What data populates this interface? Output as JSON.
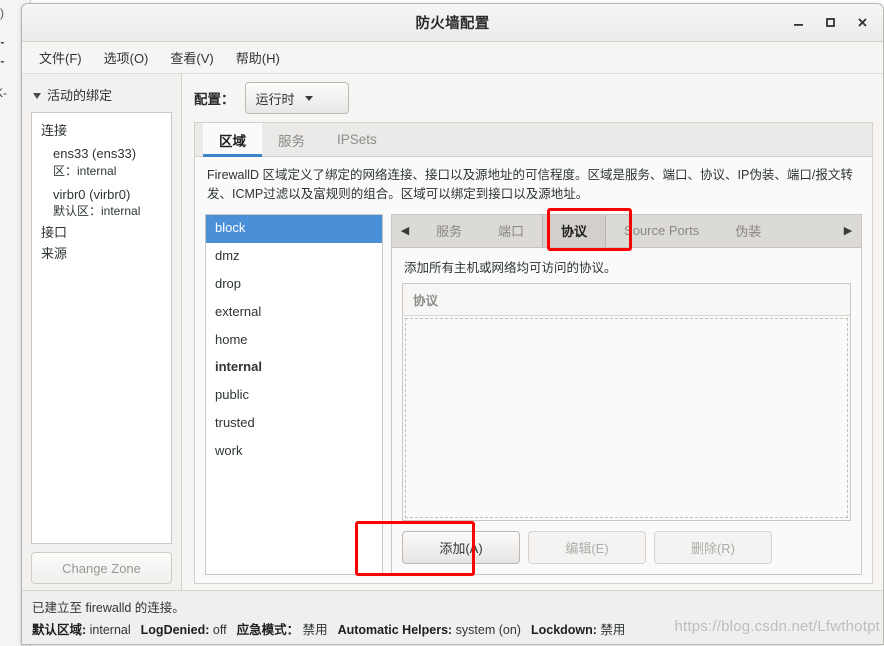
{
  "window": {
    "title": "防火墙配置",
    "controls": {
      "minimize": "minimize-icon",
      "maximize": "maximize-icon",
      "close": "close-icon"
    }
  },
  "menubar": {
    "items": [
      {
        "label": "文件(F)"
      },
      {
        "label": "选项(O)"
      },
      {
        "label": "查看(V)"
      },
      {
        "label": "帮助(H)"
      }
    ]
  },
  "sidebar": {
    "expander_label": "活动的绑定",
    "groups": [
      {
        "label": "连接"
      },
      {
        "label": "接口"
      },
      {
        "label": "来源"
      }
    ],
    "connections": [
      {
        "name": "ens33 (ens33)",
        "zone": "区：internal"
      },
      {
        "name": "virbr0 (virbr0)",
        "zone": "默认区：internal"
      }
    ],
    "change_zone_label": "Change Zone"
  },
  "config": {
    "label": "配置：",
    "selected": "运行时"
  },
  "tabs": [
    {
      "label": "区域",
      "active": true
    },
    {
      "label": "服务",
      "active": false
    },
    {
      "label": "IPSets",
      "active": false
    }
  ],
  "zone_description": "FirewallD 区域定义了绑定的网络连接、接口以及源地址的可信程度。区域是服务、端口、协议、IP伪装、端口/报文转发、ICMP过滤以及富规则的组合。区域可以绑定到接口以及源地址。",
  "zones": [
    {
      "name": "block",
      "selected": true,
      "is_default": false
    },
    {
      "name": "dmz",
      "selected": false,
      "is_default": false
    },
    {
      "name": "drop",
      "selected": false,
      "is_default": false
    },
    {
      "name": "external",
      "selected": false,
      "is_default": false
    },
    {
      "name": "home",
      "selected": false,
      "is_default": false
    },
    {
      "name": "internal",
      "selected": false,
      "is_default": true
    },
    {
      "name": "public",
      "selected": false,
      "is_default": false
    },
    {
      "name": "trusted",
      "selected": false,
      "is_default": false
    },
    {
      "name": "work",
      "selected": false,
      "is_default": false
    }
  ],
  "subtabs": {
    "prev_arrow": "◀",
    "next_arrow": "▶",
    "items": [
      {
        "label": "服务",
        "active": false
      },
      {
        "label": "端口",
        "active": false
      },
      {
        "label": "协议",
        "active": true
      },
      {
        "label": "Source Ports",
        "active": false
      },
      {
        "label": "伪装",
        "active": false
      }
    ]
  },
  "protocol_panel": {
    "description": "添加所有主机或网络均可访问的协议。",
    "column_header": "协议",
    "rows": [],
    "buttons": [
      {
        "label": "添加(A)",
        "enabled": true
      },
      {
        "label": "编辑(E)",
        "enabled": false
      },
      {
        "label": "删除(R)",
        "enabled": false
      }
    ]
  },
  "statusbar": {
    "connection_message": "已建立至 firewalld 的连接。",
    "items": [
      {
        "key": "默认区域:",
        "value": "internal"
      },
      {
        "key": "LogDenied:",
        "value": "off"
      },
      {
        "key": "应急模式：",
        "value": "禁用"
      },
      {
        "key": "Automatic Helpers:",
        "value": "system (on)"
      },
      {
        "key": "Lockdown:",
        "value": "禁用"
      }
    ]
  },
  "watermark": "https://blog.csdn.net/Lfwthotpt",
  "background_window_fragments": [
    "s)",
    "l-",
    "l-",
    "K-"
  ],
  "colors": {
    "selection": "#4a90d9",
    "tab_underline": "#3b86c9",
    "annotation": "#ff0000"
  }
}
